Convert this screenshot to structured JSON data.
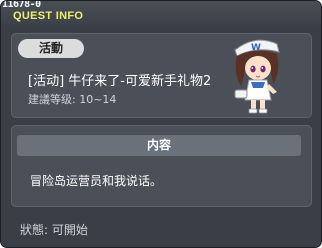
{
  "window": {
    "quest_id": "11678-0",
    "title": "QUEST INFO"
  },
  "quest": {
    "category_tag": "活動",
    "name": "[活动] 牛仔来了-可爱新手礼物2",
    "level_requirement": "建議等级: 10~14"
  },
  "content": {
    "header": "内容",
    "text": "冒险岛运营员和我说话。"
  },
  "status": {
    "text": "狀態: 可開始"
  },
  "colors": {
    "title": "#f2ee6a",
    "window_bg": "#3a3f47",
    "panel_bg": "#4b5058",
    "header_bg": "#6b717b"
  },
  "icons": [
    "npc-portrait"
  ]
}
